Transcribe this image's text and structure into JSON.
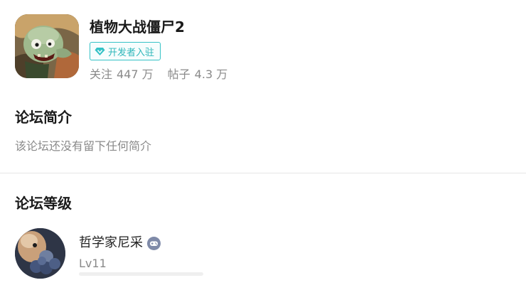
{
  "forum": {
    "name": "植物大战僵尸2",
    "badge_label": "开发者入驻",
    "stats": {
      "follow_label": "关注",
      "follow_value": "447 万",
      "posts_label": "帖子",
      "posts_value": "4.3 万"
    }
  },
  "intro": {
    "title": "论坛简介",
    "text": "该论坛还没有留下任何简介"
  },
  "level": {
    "title": "论坛等级",
    "user": {
      "name": "哲学家尼采",
      "level": "Lv11",
      "progress": 0
    }
  },
  "icons": {
    "app": "zombie-app-icon",
    "badge": "diamond-icon",
    "user_badge": "gamepad-icon"
  },
  "colors": {
    "accent": "#2fb7ba",
    "text_primary": "#1a1a1a",
    "text_secondary": "#8a8a8a",
    "divider": "#e6e6e6"
  }
}
